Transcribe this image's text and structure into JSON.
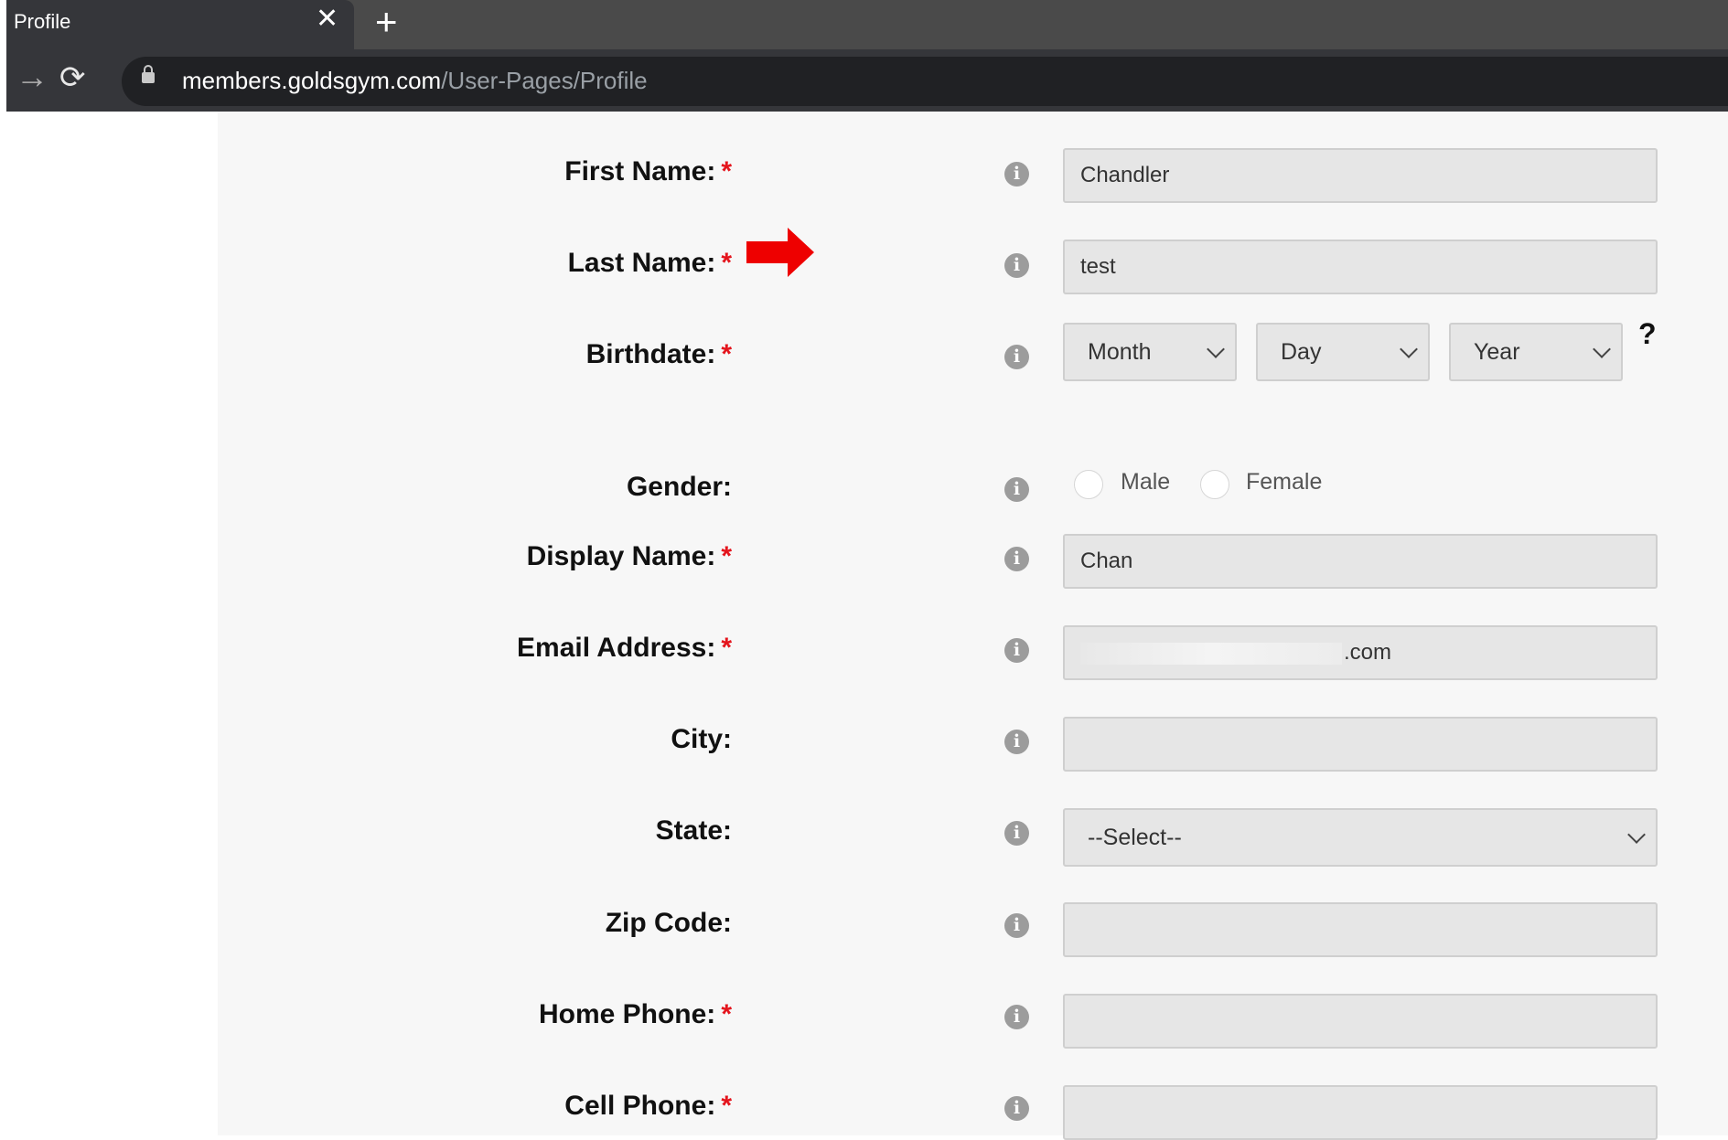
{
  "browser": {
    "tab_title": "Profile",
    "tab_close_glyph": "✕",
    "new_tab_glyph": "+",
    "forward_glyph": "→",
    "reload_glyph": "⟳",
    "url_host": "members.goldsgym.com",
    "url_path": "/User-Pages/Profile"
  },
  "colors": {
    "required_star": "#e4141c",
    "arrow": "#ee0000",
    "field_bg": "#e6e6e6",
    "page_bg": "#f7f7f7"
  },
  "form": {
    "required_mark": "*",
    "info_glyph": "i",
    "first_name": {
      "label": "First Name:",
      "value": "Chandler"
    },
    "last_name": {
      "label": "Last Name:",
      "value": "test"
    },
    "birthdate": {
      "label": "Birthdate:",
      "month": "Month",
      "day": "Day",
      "year": "Year",
      "help": "?"
    },
    "gender": {
      "label": "Gender:",
      "options": [
        "Male",
        "Female"
      ]
    },
    "display_name": {
      "label": "Display Name:",
      "value": "Chan"
    },
    "email": {
      "label": "Email Address:",
      "visible_suffix": ".com"
    },
    "city": {
      "label": "City:",
      "value": ""
    },
    "state": {
      "label": "State:",
      "value": "--Select--"
    },
    "zip": {
      "label": "Zip Code:",
      "value": ""
    },
    "home_phone": {
      "label": "Home Phone:",
      "value": ""
    },
    "cell_phone": {
      "label": "Cell Phone:",
      "value": ""
    }
  },
  "annotation": {
    "icon": "red-arrow-icon",
    "points_to": "last_name"
  }
}
